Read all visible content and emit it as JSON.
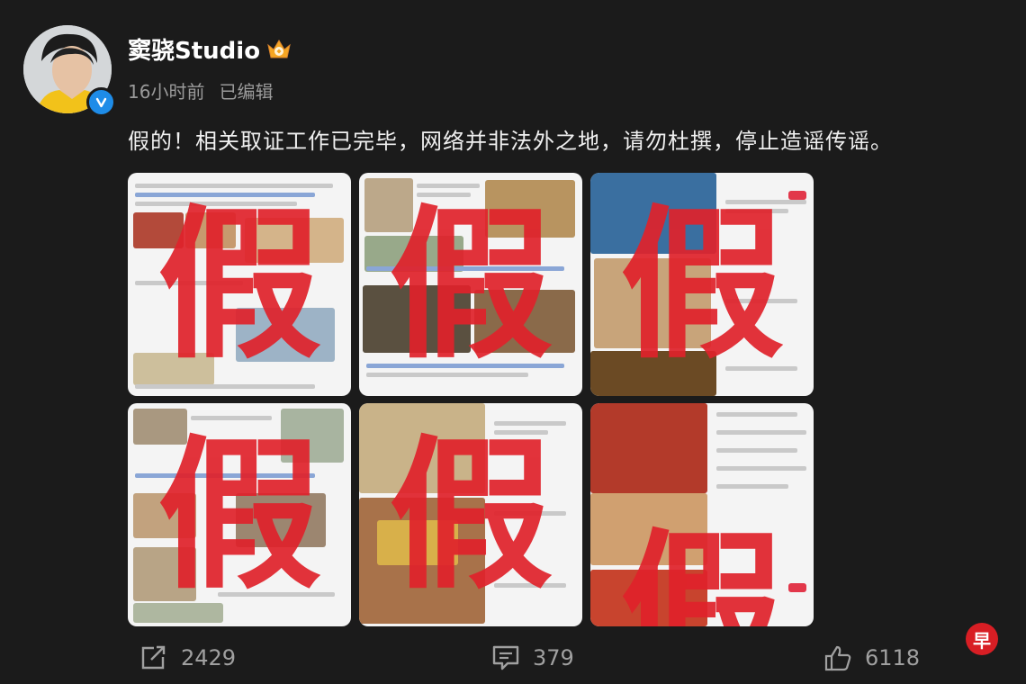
{
  "post": {
    "username": "窦骁Studio",
    "time": "16小时前",
    "edited": "已编辑",
    "text": "假的！相关取证工作已完毕，网络并非法外之地，请勿杜撰，停止造谣传谣。"
  },
  "images": [
    {
      "stamp": "假"
    },
    {
      "stamp": "假"
    },
    {
      "stamp": "假"
    },
    {
      "stamp": "假"
    },
    {
      "stamp": "假"
    },
    {
      "stamp": "假"
    }
  ],
  "actions": {
    "share_count": "2429",
    "comment_count": "379",
    "like_count": "6118"
  },
  "watermark": {
    "char": "早"
  },
  "colors": {
    "background": "#1b1b1b",
    "stamp_red": "#e0222b",
    "verified_blue": "#1e8ce8",
    "logo_red": "#d81e24"
  },
  "icons": [
    "verified-icon",
    "crown-icon",
    "share-icon",
    "comment-icon",
    "like-icon"
  ]
}
